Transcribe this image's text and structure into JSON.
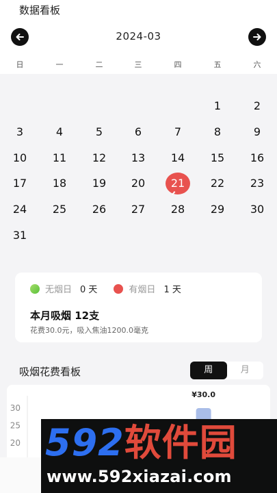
{
  "header": {
    "title": "数据看板",
    "month": "2024-03",
    "prev_icon": "arrow-left-icon",
    "next_icon": "arrow-right-icon"
  },
  "weekdays": [
    "日",
    "一",
    "二",
    "三",
    "四",
    "五",
    "六"
  ],
  "calendar": {
    "first_weekday": 5,
    "days_in_month": 31,
    "selected_day": 21,
    "selected_color": "#e8524f"
  },
  "summary": {
    "no_smoke_label": "无烟日",
    "no_smoke_value": "0 天",
    "smoke_label": "有烟日",
    "smoke_value": "1 天",
    "total": "本月吸烟 12支",
    "detail": "花费30.0元，吸入焦油1200.0毫克"
  },
  "board": {
    "title": "吸烟花费看板",
    "tabs": [
      "周",
      "月"
    ],
    "active_tab": "周"
  },
  "chart_data": {
    "type": "bar",
    "categories": [
      "",
      "",
      "",
      "",
      ""
    ],
    "values": [
      0,
      0,
      0,
      30,
      0
    ],
    "data_labels": [
      "",
      "",
      "",
      "¥30.0",
      ""
    ],
    "yticks": [
      "30",
      "25",
      "20"
    ],
    "bar_color": "#a9bde8"
  },
  "watermark": {
    "logo_num": "592",
    "logo_cn": "软件园",
    "url": "www.592xiazai.com"
  }
}
